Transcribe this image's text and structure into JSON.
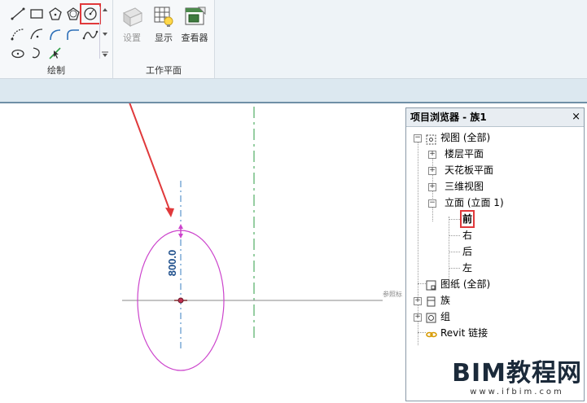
{
  "ribbon": {
    "draw_panel_label": "绘制",
    "workplane_panel_label": "工作平面",
    "buttons": {
      "settings": "设置",
      "show": "显示",
      "viewer": "查看器"
    }
  },
  "canvas": {
    "dimension_value": "800.0",
    "reference_label": "参照标"
  },
  "browser": {
    "title": "项目浏览器 - 族1",
    "close": "×",
    "nodes": {
      "views": "视图 (全部)",
      "floor_plans": "楼层平面",
      "ceiling_plans": "天花板平面",
      "3d_views": "三维视图",
      "elevations": "立面 (立面 1)",
      "front": "前",
      "right": "右",
      "back": "后",
      "left": "左",
      "sheets": "图纸 (全部)",
      "families": "族",
      "groups": "组",
      "revit_links": "Revit 链接"
    }
  },
  "watermark": {
    "main": "BIM教程网",
    "url": "www.ifbim.com"
  },
  "colors": {
    "highlight": "#e0393b",
    "ellipse": "#cc44cc",
    "refline": "#3a7fc0",
    "green_dash": "#2e9e44"
  }
}
